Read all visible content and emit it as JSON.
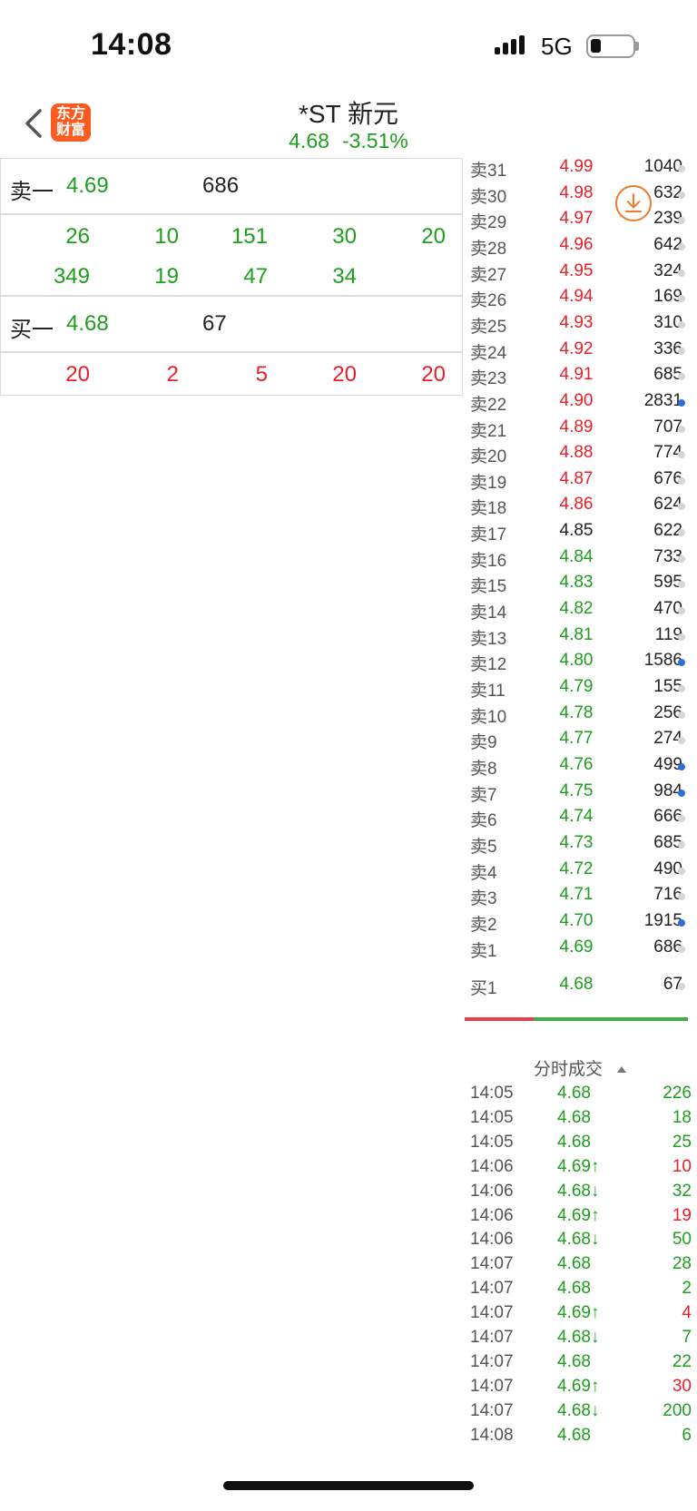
{
  "status_bar": {
    "time": "14:08",
    "network": "5G"
  },
  "nav": {
    "logo_line1": "东方",
    "logo_line2": "财富",
    "stock_name": "*ST 新元",
    "last_price": "4.68",
    "change_pct": "-3.51%"
  },
  "quote_panel": {
    "ask_label": "卖一",
    "ask_price": "4.69",
    "ask_volume": "686",
    "ask_queue_row1": [
      "26",
      "10",
      "151",
      "30",
      "20"
    ],
    "ask_queue_row2": [
      "349",
      "19",
      "47",
      "34"
    ],
    "bid_label": "买一",
    "bid_price": "4.68",
    "bid_volume": "67",
    "bid_queue": [
      "20",
      "2",
      "5",
      "20",
      "20"
    ]
  },
  "order_book": {
    "asks": [
      {
        "label": "卖31",
        "price": "4.99",
        "volume": "1040",
        "color": "red",
        "dot": "gray"
      },
      {
        "label": "卖30",
        "price": "4.98",
        "volume": "632",
        "color": "red",
        "dot": "gray"
      },
      {
        "label": "卖29",
        "price": "4.97",
        "volume": "239",
        "color": "red",
        "dot": "gray"
      },
      {
        "label": "卖28",
        "price": "4.96",
        "volume": "642",
        "color": "red",
        "dot": "gray"
      },
      {
        "label": "卖27",
        "price": "4.95",
        "volume": "324",
        "color": "red",
        "dot": "gray"
      },
      {
        "label": "卖26",
        "price": "4.94",
        "volume": "169",
        "color": "red",
        "dot": "gray"
      },
      {
        "label": "卖25",
        "price": "4.93",
        "volume": "310",
        "color": "red",
        "dot": "gray"
      },
      {
        "label": "卖24",
        "price": "4.92",
        "volume": "336",
        "color": "red",
        "dot": "gray"
      },
      {
        "label": "卖23",
        "price": "4.91",
        "volume": "685",
        "color": "red",
        "dot": "gray"
      },
      {
        "label": "卖22",
        "price": "4.90",
        "volume": "2831",
        "color": "red",
        "dot": "blue"
      },
      {
        "label": "卖21",
        "price": "4.89",
        "volume": "707",
        "color": "red",
        "dot": "gray"
      },
      {
        "label": "卖20",
        "price": "4.88",
        "volume": "774",
        "color": "red",
        "dot": "gray"
      },
      {
        "label": "卖19",
        "price": "4.87",
        "volume": "676",
        "color": "red",
        "dot": "gray"
      },
      {
        "label": "卖18",
        "price": "4.86",
        "volume": "624",
        "color": "red",
        "dot": "gray"
      },
      {
        "label": "卖17",
        "price": "4.85",
        "volume": "622",
        "color": "dark",
        "dot": "gray"
      },
      {
        "label": "卖16",
        "price": "4.84",
        "volume": "733",
        "color": "green",
        "dot": "gray"
      },
      {
        "label": "卖15",
        "price": "4.83",
        "volume": "595",
        "color": "green",
        "dot": "gray"
      },
      {
        "label": "卖14",
        "price": "4.82",
        "volume": "470",
        "color": "green",
        "dot": "gray"
      },
      {
        "label": "卖13",
        "price": "4.81",
        "volume": "119",
        "color": "green",
        "dot": "gray"
      },
      {
        "label": "卖12",
        "price": "4.80",
        "volume": "1586",
        "color": "green",
        "dot": "blue"
      },
      {
        "label": "卖11",
        "price": "4.79",
        "volume": "155",
        "color": "green",
        "dot": "gray"
      },
      {
        "label": "卖10",
        "price": "4.78",
        "volume": "256",
        "color": "green",
        "dot": "gray"
      },
      {
        "label": "卖9",
        "price": "4.77",
        "volume": "274",
        "color": "green",
        "dot": "gray"
      },
      {
        "label": "卖8",
        "price": "4.76",
        "volume": "499",
        "color": "green",
        "dot": "blue"
      },
      {
        "label": "卖7",
        "price": "4.75",
        "volume": "984",
        "color": "green",
        "dot": "blue"
      },
      {
        "label": "卖6",
        "price": "4.74",
        "volume": "666",
        "color": "green",
        "dot": "gray"
      },
      {
        "label": "卖5",
        "price": "4.73",
        "volume": "685",
        "color": "green",
        "dot": "gray"
      },
      {
        "label": "卖4",
        "price": "4.72",
        "volume": "490",
        "color": "green",
        "dot": "gray"
      },
      {
        "label": "卖3",
        "price": "4.71",
        "volume": "716",
        "color": "green",
        "dot": "gray"
      },
      {
        "label": "卖2",
        "price": "4.70",
        "volume": "1915",
        "color": "green",
        "dot": "blue"
      },
      {
        "label": "卖1",
        "price": "4.69",
        "volume": "686",
        "color": "green",
        "dot": "gray"
      }
    ],
    "bid": {
      "label": "买1",
      "price": "4.68",
      "volume": "67",
      "color": "green",
      "dot": "gray"
    }
  },
  "time_trades": {
    "title": "分时成交",
    "rows": [
      {
        "time": "14:05",
        "price": "4.68",
        "volume": "226",
        "price_color": "green",
        "vol_color": "green"
      },
      {
        "time": "14:05",
        "price": "4.68",
        "volume": "18",
        "price_color": "green",
        "vol_color": "green"
      },
      {
        "time": "14:05",
        "price": "4.68",
        "volume": "25",
        "price_color": "green",
        "vol_color": "green"
      },
      {
        "time": "14:06",
        "price": "4.69↑",
        "volume": "10",
        "price_color": "green",
        "vol_color": "red"
      },
      {
        "time": "14:06",
        "price": "4.68↓",
        "volume": "32",
        "price_color": "green",
        "vol_color": "green"
      },
      {
        "time": "14:06",
        "price": "4.69↑",
        "volume": "19",
        "price_color": "green",
        "vol_color": "red"
      },
      {
        "time": "14:06",
        "price": "4.68↓",
        "volume": "50",
        "price_color": "green",
        "vol_color": "green"
      },
      {
        "time": "14:07",
        "price": "4.68",
        "volume": "28",
        "price_color": "green",
        "vol_color": "green"
      },
      {
        "time": "14:07",
        "price": "4.68",
        "volume": "2",
        "price_color": "green",
        "vol_color": "green"
      },
      {
        "time": "14:07",
        "price": "4.69↑",
        "volume": "4",
        "price_color": "green",
        "vol_color": "red"
      },
      {
        "time": "14:07",
        "price": "4.68↓",
        "volume": "7",
        "price_color": "green",
        "vol_color": "green"
      },
      {
        "time": "14:07",
        "price": "4.68",
        "volume": "22",
        "price_color": "green",
        "vol_color": "green"
      },
      {
        "time": "14:07",
        "price": "4.69↑",
        "volume": "30",
        "price_color": "green",
        "vol_color": "red"
      },
      {
        "time": "14:07",
        "price": "4.68↓",
        "volume": "200",
        "price_color": "green",
        "vol_color": "green"
      },
      {
        "time": "14:08",
        "price": "4.68",
        "volume": "6",
        "price_color": "green",
        "vol_color": "green"
      }
    ]
  },
  "colors": {
    "up": "#e8202a",
    "down": "#1e9e1e",
    "brand": "#ff5a1f",
    "dot_active": "#2f6fd6"
  }
}
